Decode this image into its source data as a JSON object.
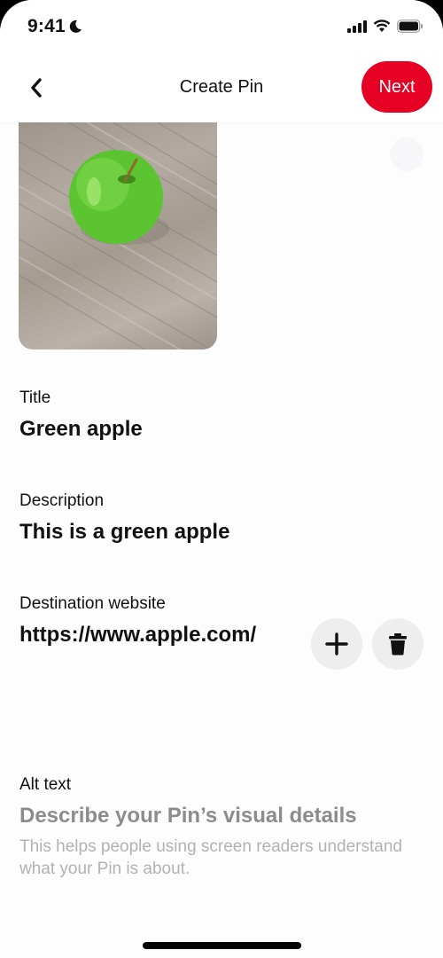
{
  "status_bar": {
    "time": "9:41",
    "icons": [
      "moon-icon",
      "signal-icon",
      "wifi-icon",
      "battery-icon"
    ]
  },
  "header": {
    "back_icon": "chevron-left-icon",
    "title": "Create Pin",
    "next_label": "Next",
    "accent_color": "#e60023"
  },
  "pin_image": {
    "description": "green apple on wooden surface"
  },
  "fields": {
    "title": {
      "label": "Title",
      "value": "Green apple"
    },
    "description": {
      "label": "Description",
      "value": "This is a green apple"
    },
    "destination": {
      "label": "Destination website",
      "value": "https://www.apple.com/",
      "add_icon": "plus-icon",
      "delete_icon": "trash-icon"
    },
    "alt_text": {
      "label": "Alt text",
      "placeholder": "Describe your Pin’s visual details",
      "hint": "This helps people using screen readers understand what your Pin is about."
    }
  }
}
